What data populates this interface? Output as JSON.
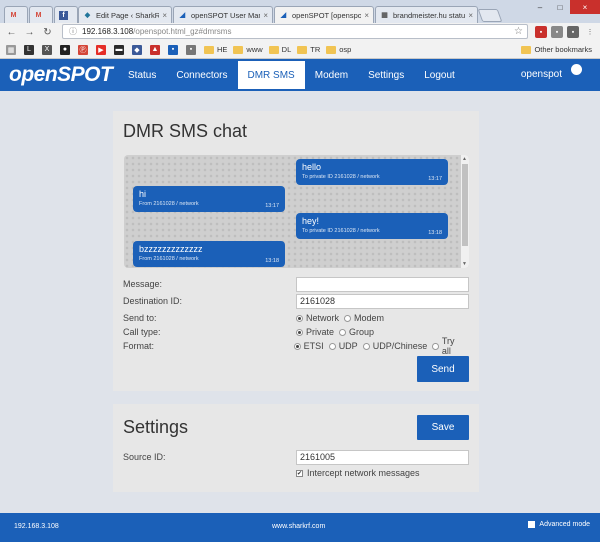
{
  "browser": {
    "tabs": [
      {
        "label": "",
        "icon": "gmail-icon"
      },
      {
        "label": "",
        "icon": "gmail-icon"
      },
      {
        "label": "",
        "icon": "facebook-icon"
      },
      {
        "label": "Edit Page ‹ SharkRF — W",
        "icon": "wordpress-icon"
      },
      {
        "label": "openSPOT User Manual",
        "icon": "page-icon"
      },
      {
        "label": "openSPOT [openspot]",
        "icon": "page-icon"
      },
      {
        "label": "brandmeister.hu status",
        "icon": "table-icon"
      }
    ],
    "address": {
      "host": "192.168.3.108",
      "path": "/openspot.html_gz#dmrsms"
    },
    "bookmarks": [
      "",
      "",
      "HE",
      "www",
      "DL",
      "TR",
      "osp"
    ],
    "other_bookmarks": "Other bookmarks"
  },
  "header": {
    "logo": "openSPOT",
    "nav": [
      "Status",
      "Connectors",
      "DMR SMS",
      "Modem",
      "Settings",
      "Logout"
    ],
    "active_nav": "DMR SMS",
    "user": "openspot"
  },
  "sms": {
    "title": "DMR SMS chat",
    "messages": [
      {
        "direction": "out",
        "text": "hello",
        "meta": "To private ID 2161028 / network",
        "time": "13:17"
      },
      {
        "direction": "in",
        "text": "hi",
        "meta": "From 2161028 / network",
        "time": "13:17"
      },
      {
        "direction": "out",
        "text": "hey!",
        "meta": "To private ID 2161028 / network",
        "time": "13:18"
      },
      {
        "direction": "in",
        "text": "bzzzzzzzzzzzzz",
        "meta": "From 2161028 / network",
        "time": "13:18"
      }
    ],
    "form": {
      "message_label": "Message:",
      "message_value": "",
      "destination_label": "Destination ID:",
      "destination_value": "2161028",
      "send_to_label": "Send to:",
      "send_to_options": [
        "Network",
        "Modem"
      ],
      "send_to_selected": "Network",
      "call_type_label": "Call type:",
      "call_type_options": [
        "Private",
        "Group"
      ],
      "call_type_selected": "Private",
      "format_label": "Format:",
      "format_options": [
        "ETSI",
        "UDP",
        "UDP/Chinese",
        "Try all"
      ],
      "format_selected": "ETSI"
    },
    "send_label": "Send"
  },
  "settings": {
    "title": "Settings",
    "save_label": "Save",
    "source_id_label": "Source ID:",
    "source_id_value": "2161005",
    "intercept_label": "Intercept network messages",
    "intercept_checked": true
  },
  "footer": {
    "ip": "192.168.3.108",
    "site": "www.sharkrf.com",
    "advanced_label": "Advanced mode",
    "advanced_checked": false
  },
  "colors": {
    "brand": "#1b60b8",
    "panel": "#e7e7e7",
    "page": "#dfe3ea"
  }
}
